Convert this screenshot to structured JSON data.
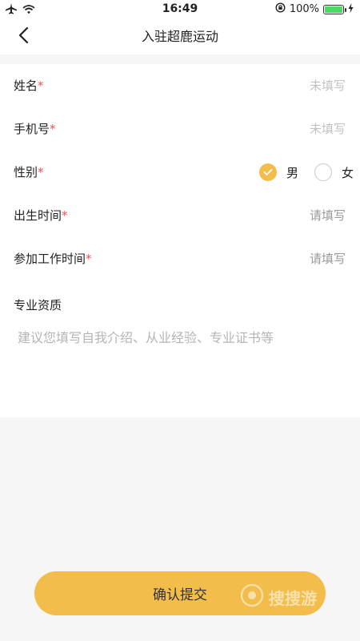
{
  "status_bar": {
    "time": "16:49",
    "battery_percent": "100%",
    "battery_level": 1.0,
    "icons": [
      "airplane-icon",
      "wifi-icon",
      "rotation-lock-icon",
      "battery-icon",
      "charging-icon"
    ]
  },
  "nav": {
    "back_icon": "chevron-left-icon",
    "title": "入驻超鹿运动"
  },
  "form": {
    "name": {
      "label": "姓名",
      "required_mark": "*",
      "placeholder": "未填写"
    },
    "phone": {
      "label": "手机号",
      "required_mark": "*",
      "placeholder": "未填写"
    },
    "gender": {
      "label": "性别",
      "required_mark": "*",
      "options": [
        {
          "label": "男",
          "selected": true
        },
        {
          "label": "女",
          "selected": false
        }
      ]
    },
    "birth": {
      "label": "出生时间",
      "required_mark": "*",
      "placeholder": "请填写"
    },
    "work_start": {
      "label": "参加工作时间",
      "required_mark": "*",
      "placeholder": "请填写"
    },
    "qualification": {
      "label": "专业资质",
      "placeholder": "建议您填写自我介绍、从业经验、专业证书等"
    }
  },
  "submit": {
    "label": "确认提交"
  },
  "watermark": {
    "text": "搜搜游"
  },
  "colors": {
    "accent": "#f2bd4a",
    "required": "#ff4d4f",
    "placeholder_light": "#c2c2c2",
    "placeholder_dark": "#9a9a9a",
    "page_bg": "#f6f6f6"
  }
}
